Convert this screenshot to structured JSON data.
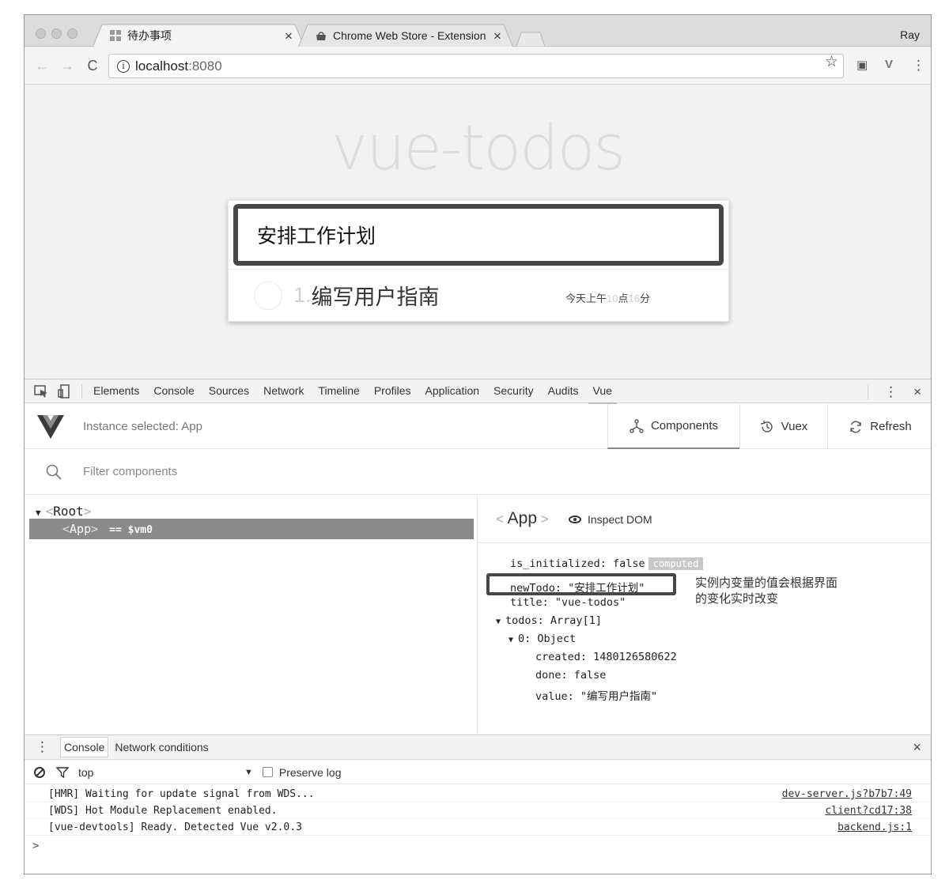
{
  "browser": {
    "tabs": [
      {
        "title": "待办事项",
        "close": "×"
      },
      {
        "title": "Chrome Web Store - Extension",
        "close": "×"
      }
    ],
    "user": "Ray",
    "nav": {
      "back": "←",
      "forward": "→",
      "reload": "C"
    },
    "address": {
      "info": "i",
      "host": "localhost",
      "port": ":8080"
    },
    "icons": {
      "bookmark": "☆",
      "ext1": "▣",
      "ext_vue": "V",
      "menu": "⋮"
    }
  },
  "page": {
    "app_title": "vue-todos",
    "new_todo_value": "安排工作计划",
    "todos": [
      {
        "index": "1.",
        "text": "编写用户指南",
        "time_prefix": "今天上午",
        "hour": "10",
        "hour_unit": "点",
        "minute": "16",
        "minute_unit": "分"
      }
    ]
  },
  "devtools": {
    "tabs": [
      "Elements",
      "Console",
      "Sources",
      "Network",
      "Timeline",
      "Profiles",
      "Application",
      "Security",
      "Audits",
      "Vue"
    ],
    "active_tab": "Vue",
    "right_icons": {
      "more": "⋮",
      "close": "×"
    },
    "vue": {
      "instance_selected": "Instance selected: App",
      "buttons": {
        "components": "Components",
        "vuex": "Vuex",
        "refresh": "Refresh"
      },
      "filter_placeholder": "Filter components",
      "tree": {
        "root": "Root",
        "app": "App",
        "vm": "== $vm0"
      },
      "inspect": {
        "component": "App",
        "inspect_dom": "Inspect DOM",
        "props": {
          "is_initialized": "is_initialized: false",
          "computed_badge": "computed",
          "new_todo": "newTodo: \"安排工作计划\"",
          "title": "title: \"vue-todos\"",
          "todos": "todos: Array[1]",
          "item0": "0: Object",
          "created": "created: 1480126580622",
          "done": "done: false",
          "value": "value: \"编写用户指南\""
        },
        "annotation_line1": "实例内变量的值会根据界面",
        "annotation_line2": "的变化实时改变"
      }
    },
    "drawer": {
      "tabs": [
        "Console",
        "Network conditions"
      ],
      "active_tab": "Console",
      "context": "top",
      "preserve_log": "Preserve log",
      "close": "×",
      "logs": [
        {
          "text": "[HMR] Waiting for update signal from WDS...",
          "source": "dev-server.js?b7b7:49"
        },
        {
          "text": "[WDS] Hot Module Replacement enabled.",
          "source": "client?cd17:38"
        },
        {
          "text": "[vue-devtools] Ready. Detected Vue v2.0.3",
          "source": "backend.js:1"
        }
      ],
      "prompt": ">"
    }
  }
}
